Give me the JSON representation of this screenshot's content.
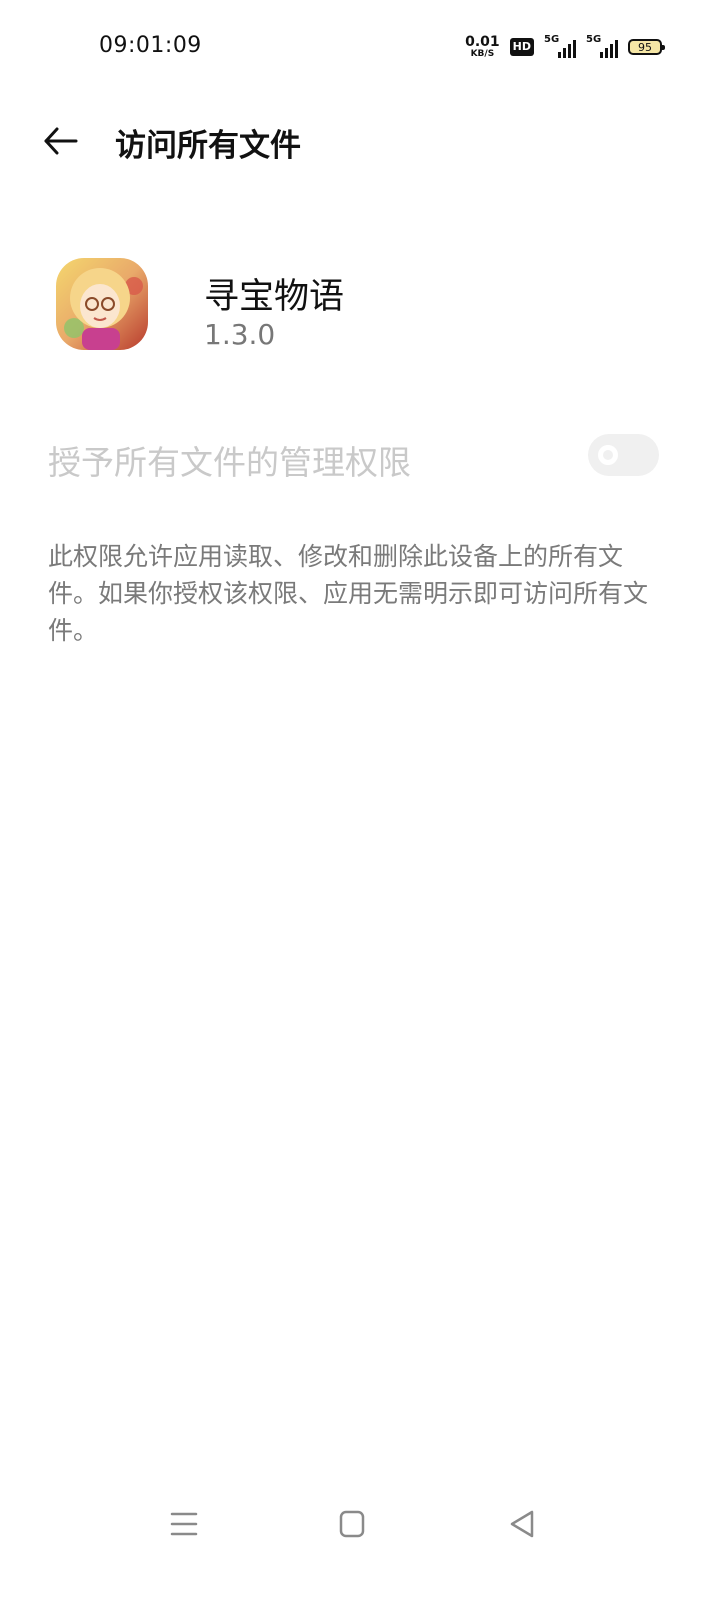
{
  "status_bar": {
    "time": "09:01:09",
    "net_speed_value": "0.01",
    "net_speed_unit": "KB/S",
    "hd_label": "HD",
    "signal1_label": "5G",
    "signal2_label": "5G",
    "battery_level": "95",
    "battery_color": "#f6e7a6"
  },
  "header": {
    "back_icon": "arrow-left-icon",
    "title": "访问所有文件"
  },
  "app": {
    "name": "寻宝物语",
    "version": "1.3.0",
    "icon": "app-avatar-icon"
  },
  "permission": {
    "label": "授予所有文件的管理权限",
    "toggle_state": "off",
    "description": "此权限允许应用读取、修改和删除此设备上的所有文件。如果你授权该权限、应用无需明示即可访问所有文件。"
  },
  "nav_bar": {
    "menu_icon": "menu-icon",
    "home_icon": "home-icon",
    "back_icon": "back-triangle-icon"
  }
}
